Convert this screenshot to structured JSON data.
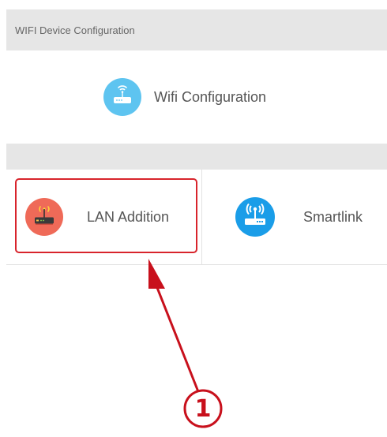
{
  "sections": {
    "wifi_device_configuration": "WIFI Device Configuration",
    "second_header": ""
  },
  "wifi_configuration": {
    "label": "Wifi Configuration",
    "icon": "router-wifi-icon",
    "icon_color": "#5ec4f0"
  },
  "options": [
    {
      "label": "LAN Addition",
      "icon": "router-antenna-icon",
      "icon_color": "#ef6a58",
      "highlighted": true
    },
    {
      "label": "Smartlink",
      "icon": "smartlink-router-icon",
      "icon_color": "#1a9de8",
      "highlighted": false
    }
  ],
  "annotation": {
    "step_number": "1",
    "color": "#c8101c"
  }
}
